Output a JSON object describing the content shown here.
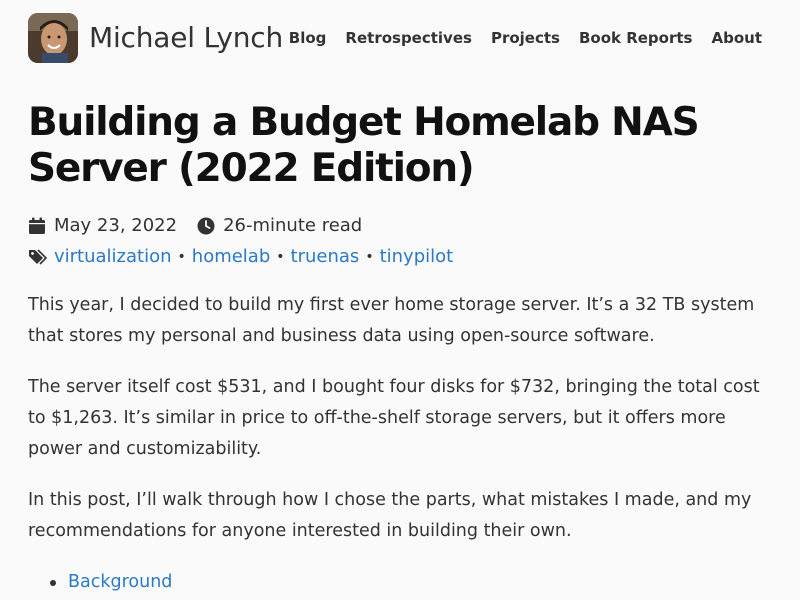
{
  "site": {
    "title": "Michael Lynch",
    "nav": [
      "Blog",
      "Retrospectives",
      "Projects",
      "Book Reports",
      "About"
    ]
  },
  "article": {
    "title": "Building a Budget Homelab NAS Server (2022 Edition)",
    "date": "May 23, 2022",
    "read_time": "26-minute read",
    "tags": [
      "virtualization",
      "homelab",
      "truenas",
      "tinypilot"
    ],
    "paragraphs": [
      "This year, I decided to build my first ever home storage server. It’s a 32 TB system that stores my personal and business data using open-source software.",
      "The server itself cost $531, and I bought four disks for $732, bringing the total cost to $1,263. It’s similar in price to off-the-shelf storage servers, but it offers more power and customizability.",
      "In this post, I’ll walk through how I chose the parts, what mistakes I made, and my recommendations for anyone interested in building their own."
    ],
    "toc": [
      "Background"
    ]
  },
  "colors": {
    "link": "#2a7ac7",
    "text": "#333333",
    "background": "#fafafa"
  },
  "icons": {
    "date": "calendar-icon",
    "read_time": "clock-icon",
    "tags": "tag-icon"
  }
}
